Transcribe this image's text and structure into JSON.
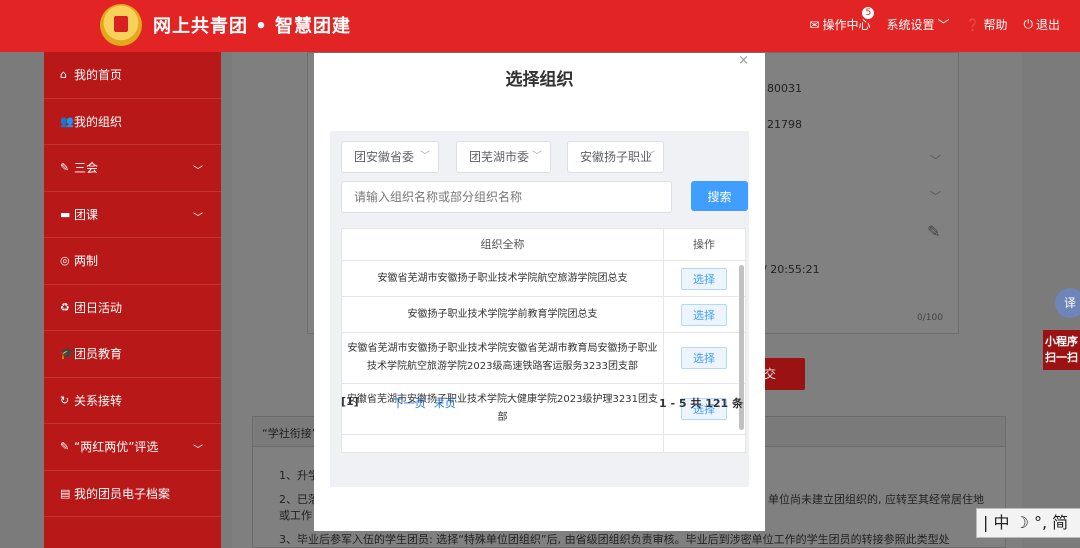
{
  "header": {
    "brand": "网上共青团 • 智慧团建",
    "nav": {
      "ops_center": "操作中心",
      "ops_badge": "5",
      "settings": "系统设置",
      "help": "帮助",
      "logout": "退出"
    }
  },
  "sidebar": {
    "items": [
      {
        "label": "我的首页",
        "icon": "home-icon",
        "glyph": "⌂"
      },
      {
        "label": "我的组织",
        "icon": "users-icon",
        "glyph": "👥"
      },
      {
        "label": "三会",
        "icon": "edit-icon",
        "glyph": "✎"
      },
      {
        "label": "团课",
        "icon": "folder-icon",
        "glyph": "▬"
      },
      {
        "label": "两制",
        "icon": "circle-icon",
        "glyph": "◎"
      },
      {
        "label": "团日活动",
        "icon": "recycle-icon",
        "glyph": "♻"
      },
      {
        "label": "团员教育",
        "icon": "graduation-icon",
        "glyph": "🎓"
      },
      {
        "label": "关系接转",
        "icon": "refresh-icon",
        "glyph": "↻"
      },
      {
        "label": "“两红两优”评选",
        "icon": "edit-icon",
        "glyph": "✎"
      },
      {
        "label": "我的团员电子档案",
        "icon": "file-icon",
        "glyph": "▤"
      }
    ]
  },
  "background": {
    "id_fragment_1": "80031",
    "id_fragment_2": "21798",
    "time_fragment": "/ 20:55:21",
    "counter": "0/100",
    "submit_fragment": "交",
    "panel_title": "“学社衔接”",
    "line1": "1、升学",
    "line2a": "2、已落",
    "line2b": "单位尚未建立团组织的, 应转至其经常居住地",
    "line2c": "或工作",
    "line3": "3、毕业后参军入伍的学生团员: 选择“特殊单位团组织”后, 由省级团组织负责审核。毕业后到涉密单位工作的学生团员的转接参照此类型处",
    "right_tab": "小程序 扫一扫",
    "translate": "译",
    "ime": "| 中 ☽ °, 简"
  },
  "modal": {
    "title": "选择组织",
    "close": "×",
    "selects": [
      "团安徽省委",
      "团芜湖市委",
      "安徽扬子职业"
    ],
    "search_placeholder": "请输入组织名称或部分组织名称",
    "search_button": "搜索",
    "table": {
      "col_name": "组织全称",
      "col_action": "操作",
      "rows": [
        {
          "name": "安徽省芜湖市安徽扬子职业技术学院航空旅游学院团总支",
          "action": "选择"
        },
        {
          "name": "安徽扬子职业技术学院学前教育学院团总支",
          "action": "选择"
        },
        {
          "name": "安徽省芜湖市安徽扬子职业技术学院安徽省芜湖市教育局安徽扬子职业技术学院航空旅游学院2023级高速铁路客运服务3233团支部",
          "action": "选择"
        },
        {
          "name": "安徽省芜湖市安徽扬子职业技术学院大健康学院2023级护理3231团支部",
          "action": "选择"
        }
      ]
    },
    "pager": {
      "current": "[1]",
      "next": "下一页",
      "last": "末页",
      "info": "1 - 5  共 121 条"
    }
  }
}
